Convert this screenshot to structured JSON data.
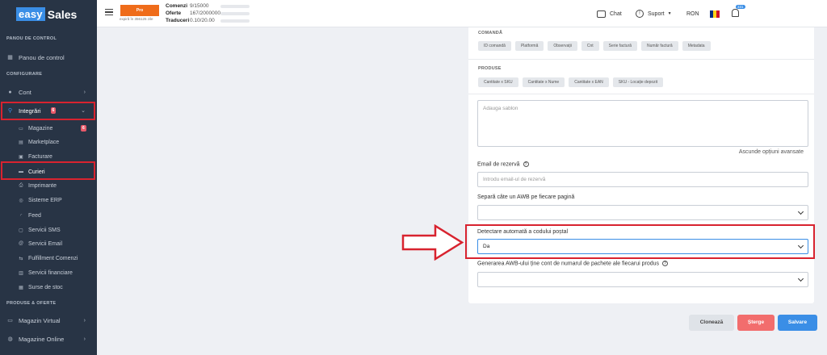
{
  "logo": {
    "part1": "easy",
    "part2": "Sales"
  },
  "sidebar": {
    "sections": [
      "PANOU DE CONTROL",
      "CONFIGURARE",
      "PRODUSE & OFERTE"
    ],
    "items": [
      {
        "label": "Panou de control",
        "icon": "dashboard-icon"
      },
      {
        "label": "Cont",
        "icon": "user-icon"
      },
      {
        "label": "Integrări",
        "icon": "link-icon",
        "badge": "6"
      },
      {
        "label": "Magazine",
        "icon": "store-icon",
        "badge": "6"
      },
      {
        "label": "Marketplace",
        "icon": "marketplace-icon"
      },
      {
        "label": "Facturare",
        "icon": "invoice-icon"
      },
      {
        "label": "Curieri",
        "icon": "truck-icon"
      },
      {
        "label": "Imprimante",
        "icon": "printer-icon"
      },
      {
        "label": "Sisteme ERP",
        "icon": "erp-icon"
      },
      {
        "label": "Feed",
        "icon": "rss-icon"
      },
      {
        "label": "Servicii SMS",
        "icon": "sms-icon"
      },
      {
        "label": "Servicii Email",
        "icon": "at-icon"
      },
      {
        "label": "Fulfillment Comenzi",
        "icon": "fulfillment-icon"
      },
      {
        "label": "Servicii financiare",
        "icon": "finance-icon"
      },
      {
        "label": "Surse de stoc",
        "icon": "stock-icon"
      },
      {
        "label": "Magazin Virtual",
        "icon": "cart-icon"
      },
      {
        "label": "Magazine Online",
        "icon": "globe-icon"
      }
    ]
  },
  "topbar": {
    "plan": "Pro",
    "plan_expiry": "expiră în 356125 zile",
    "quotas": [
      {
        "label": "Comenzi",
        "value": "9/15000"
      },
      {
        "label": "Oferte",
        "value": "167/2000000"
      },
      {
        "label": "Traduceri",
        "value": "0.10/20.00"
      }
    ],
    "chat": "Chat",
    "support": "Suport",
    "currency": "RON",
    "notifications": "331"
  },
  "panel": {
    "order_label": "COMANDĂ",
    "order_chips": [
      "ID comandă",
      "Platformă",
      "Observații",
      "Cnt",
      "Serie factură",
      "Număr factură",
      "Metadata"
    ],
    "products_label": "PRODUSE",
    "product_chips": [
      "Cantitate x SKU",
      "Cantitate x Nume",
      "Cantitate x EAN",
      "SKU - Locație depozit"
    ],
    "template_placeholder": "Adauga sablon",
    "hide_advanced": "Ascunde opțiuni avansate",
    "backup_email_label": "Email de rezervă",
    "backup_email_placeholder": "Introdu email-ul de rezervă",
    "separate_awb_label": "Separă câte un AWB pe fiecare pagină",
    "auto_postal_label": "Detectare automată a codului poștal",
    "auto_postal_value": "Da",
    "awb_packages_label": "Generarea AWB-ului ține cont de numarul de pachete ale fiecarui produs"
  },
  "actions": {
    "clone": "Clonează",
    "delete": "Șterge",
    "save": "Salvare"
  },
  "colors": {
    "sidebar": "#283445",
    "accent": "#3a8ee6",
    "highlight": "#d8232f",
    "danger": "#f26d6d",
    "plan": "#ef6c1a"
  }
}
